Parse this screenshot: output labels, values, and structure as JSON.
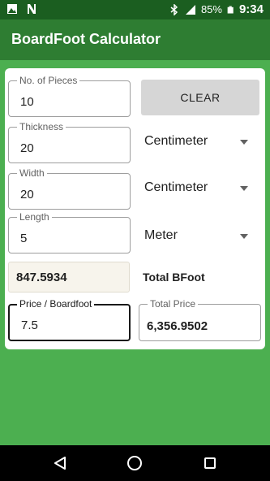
{
  "status": {
    "battery": "85%",
    "time": "9:34"
  },
  "app": {
    "title": "BoardFoot Calculator"
  },
  "form": {
    "pieces": {
      "label": "No. of Pieces",
      "value": "10"
    },
    "thickness": {
      "label": "Thickness",
      "value": "20",
      "unit": "Centimeter"
    },
    "width": {
      "label": "Width",
      "value": "20",
      "unit": "Centimeter"
    },
    "length": {
      "label": "Length",
      "value": "5",
      "unit": "Meter"
    },
    "clear_label": "CLEAR",
    "total_bfoot_value": "847.5934",
    "total_bfoot_label": "Total BFoot",
    "price": {
      "label": "Price / Boardfoot",
      "value": "7.5"
    },
    "total_price": {
      "label": "Total Price",
      "value": "6,356.9502"
    }
  },
  "icons": {
    "status_left": [
      "image-icon",
      "n-notification-icon"
    ],
    "status_right": [
      "bluetooth-icon",
      "signal-icon",
      "battery-icon"
    ],
    "nav": [
      "back-icon",
      "home-icon",
      "recents-icon"
    ]
  },
  "colors": {
    "background": "#4CAF50",
    "appbar": "#2E7D32",
    "statusbar": "#1B5E20"
  }
}
